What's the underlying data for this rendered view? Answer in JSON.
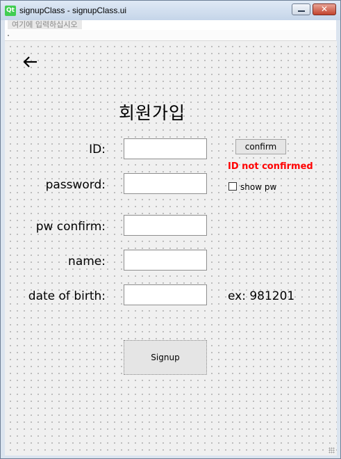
{
  "window": {
    "title": "signupClass - signupClass.ui",
    "logo_text": "Qt"
  },
  "menubar": {
    "placeholder": "여기에 입력하십시오"
  },
  "toolbar": {
    "minimize_icon": "minimize-icon",
    "close_label": "✕"
  },
  "form": {
    "back_icon": "back-arrow-icon",
    "heading": "회원가입",
    "labels": {
      "id": "ID:",
      "password": "password:",
      "pw_confirm": "pw confirm:",
      "name": "name:",
      "dob": "date of birth:"
    },
    "values": {
      "id": "",
      "password": "",
      "pw_confirm": "",
      "name": "",
      "dob": ""
    },
    "confirm_button": "confirm",
    "id_status": "ID not confirmed",
    "show_pw_label": "show pw",
    "show_pw_checked": false,
    "dob_example": "ex: 981201",
    "signup_button": "Signup"
  },
  "colors": {
    "warning": "#ff0000",
    "qt_green": "#41cd52"
  }
}
